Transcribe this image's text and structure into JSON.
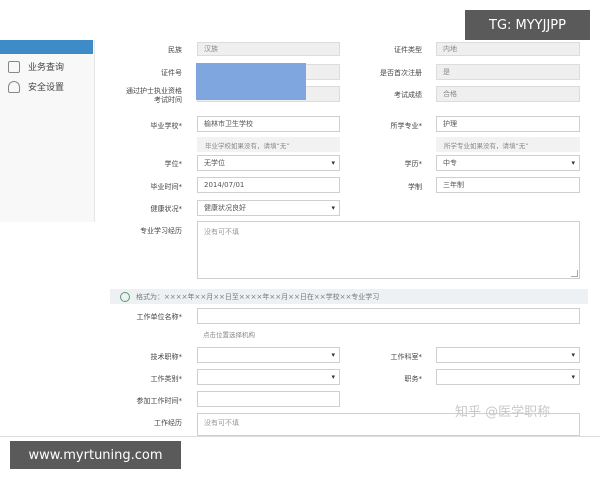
{
  "overlay": {
    "tag": "TG: MYYJJPP",
    "footer_url": "www.myrtuning.com",
    "watermark": "知乎 @医学职称"
  },
  "sidebar": {
    "items": [
      {
        "label": "业务查询",
        "icon": "query-icon"
      },
      {
        "label": "安全设置",
        "icon": "user-icon"
      }
    ]
  },
  "form": {
    "ethnicity": {
      "label": "民族",
      "value": "汉族"
    },
    "id_type": {
      "label": "证件类型",
      "value": "内地"
    },
    "id_number": {
      "label": "证件号",
      "value": ""
    },
    "first_registration": {
      "label": "是否首次注册",
      "value": "是"
    },
    "exam": {
      "label": "通过护士执业资格考试时间",
      "line1": "通过护士执业资格",
      "line2": "考试时间",
      "value": ""
    },
    "exam_result": {
      "label": "考试成绩",
      "value": "合格"
    },
    "school": {
      "label": "毕业学校*",
      "value": "榆林市卫生学校",
      "hint": "毕业学校如果没有，请填“无”"
    },
    "major": {
      "label": "所学专业*",
      "value": "护理",
      "hint": "所学专业如果没有，请填“无”"
    },
    "degree": {
      "label": "学位*",
      "value": "无学位"
    },
    "education": {
      "label": "学历*",
      "value": "中专"
    },
    "grad_date": {
      "label": "毕业时间*",
      "value": "2014/07/01"
    },
    "study_length": {
      "label": "学制",
      "value": "三年制"
    },
    "health": {
      "label": "健康状况*",
      "value": "健康状况良好"
    },
    "study_history": {
      "label": "专业学习经历",
      "placeholder": "没有可不填"
    },
    "notice": "格式为：××××年××月××日至××××年××月××日在××学校××专业学习",
    "employer": {
      "label": "工作单位名称*",
      "value": "",
      "hint": "点击位置选择机构"
    },
    "tech_title": {
      "label": "技术职称*",
      "value": ""
    },
    "department": {
      "label": "工作科室*",
      "value": ""
    },
    "job_category": {
      "label": "工作类别*",
      "value": ""
    },
    "position": {
      "label": "职务*",
      "value": ""
    },
    "work_start": {
      "label": "参加工作时间*",
      "value": ""
    },
    "work_history": {
      "label": "工作经历",
      "placeholder": "没有可不填"
    }
  },
  "colors": {
    "sidebar_active": "#3d8bc7",
    "redacted_block": "#7fa6de",
    "notice_icon": "#5a9c6a",
    "overlay_bg": "#5a5a5a"
  }
}
